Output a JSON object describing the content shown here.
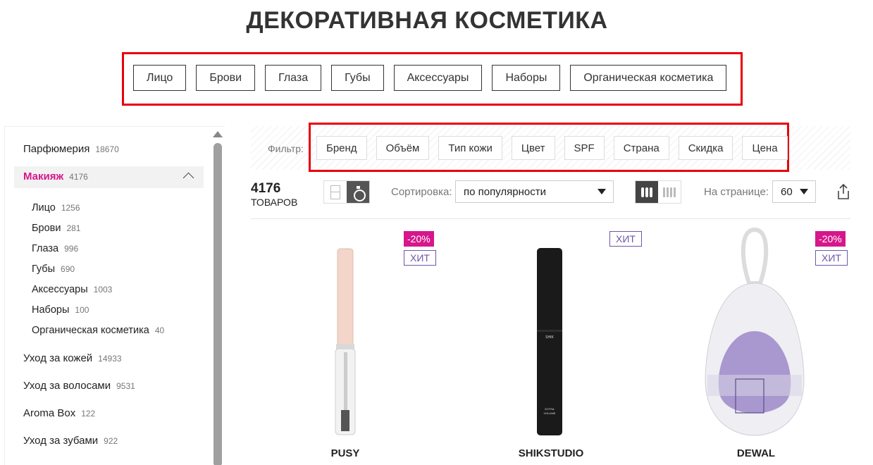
{
  "page_title": "ДЕКОРАТИВНАЯ КОСМЕТИКА",
  "categories": [
    "Лицо",
    "Брови",
    "Глаза",
    "Губы",
    "Аксессуары",
    "Наборы",
    "Органическая косметика"
  ],
  "sidebar": {
    "items": [
      {
        "label": "Парфюмерия",
        "count": "18670"
      },
      {
        "label": "Макияж",
        "count": "4176"
      },
      {
        "label": "Лицо",
        "count": "1256"
      },
      {
        "label": "Брови",
        "count": "281"
      },
      {
        "label": "Глаза",
        "count": "996"
      },
      {
        "label": "Губы",
        "count": "690"
      },
      {
        "label": "Аксессуары",
        "count": "1003"
      },
      {
        "label": "Наборы",
        "count": "100"
      },
      {
        "label": "Органическая косметика",
        "count": "40"
      },
      {
        "label": "Уход за кожей",
        "count": "14933"
      },
      {
        "label": "Уход за волосами",
        "count": "9531"
      },
      {
        "label": "Aroma Box",
        "count": "122"
      },
      {
        "label": "Уход за зубами",
        "count": "922"
      }
    ]
  },
  "filters": {
    "label": "Фильтр:",
    "buttons": [
      "Бренд",
      "Объём",
      "Тип кожи",
      "Цвет",
      "SPF",
      "Страна",
      "Скидка",
      "Цена"
    ]
  },
  "toolbar": {
    "count": "4176",
    "count_label": "ТОВАРОВ",
    "sort_label": "Сортировка:",
    "sort_value": "по популярности",
    "per_page_label": "На странице:",
    "per_page_value": "60"
  },
  "products": [
    {
      "brand": "PUSY",
      "sale": "-20%",
      "hit": "ХИТ"
    },
    {
      "brand": "SHIKSTUDIO",
      "hit": "ХИТ"
    },
    {
      "brand": "DEWAL",
      "sale": "-20%",
      "hit": "ХИТ"
    }
  ],
  "icons": {
    "collapse": "chevron-up-icon",
    "scroll": "scroll-up-arrow-icon",
    "view_card": "card-view-icon",
    "view_bottle": "bottle-view-icon",
    "sort_dropdown": "triangle-down-icon",
    "share": "share-icon"
  },
  "colors": {
    "accent": "#d6168b",
    "hit_badge": "#6f56a8",
    "highlight_outline": "#e8000b"
  }
}
